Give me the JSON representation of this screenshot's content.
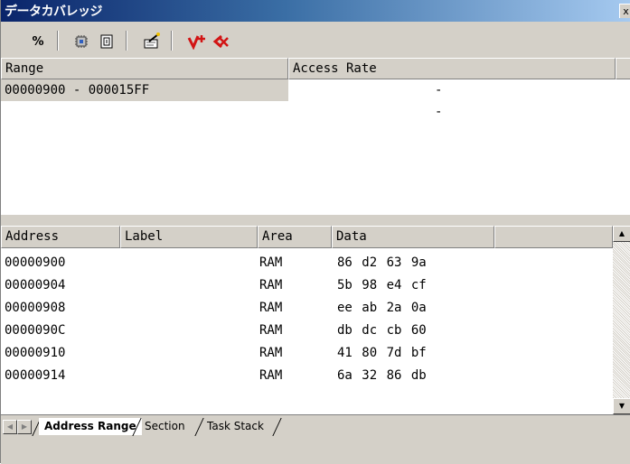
{
  "window": {
    "title": "データカバレッジ",
    "close_label": "x"
  },
  "toolbar": {
    "buttons": [
      {
        "name": "percent-button",
        "icon": "percent-icon",
        "label": "%"
      },
      {
        "name": "settings-button",
        "icon": "chip-settings-icon"
      },
      {
        "name": "info-button",
        "icon": "document-info-icon"
      },
      {
        "name": "edit-range-button",
        "icon": "wand-edit-icon"
      },
      {
        "name": "add-range-button",
        "icon": "add-red-icon"
      },
      {
        "name": "remove-range-button",
        "icon": "remove-red-icon"
      }
    ]
  },
  "range_table": {
    "headers": [
      "Range",
      "Access Rate"
    ],
    "rows": [
      {
        "range": "00000900 - 000015FF",
        "rate": "--"
      }
    ]
  },
  "data_table": {
    "headers": [
      "Address",
      "Label",
      "Area",
      "Data"
    ],
    "rows": [
      {
        "address": "00000900",
        "label": "",
        "area": "RAM",
        "data": "86 d2 63 9a"
      },
      {
        "address": "00000904",
        "label": "",
        "area": "RAM",
        "data": "5b 98 e4 cf"
      },
      {
        "address": "00000908",
        "label": "",
        "area": "RAM",
        "data": "ee ab 2a 0a"
      },
      {
        "address": "0000090C",
        "label": "",
        "area": "RAM",
        "data": "db dc cb 60"
      },
      {
        "address": "00000910",
        "label": "",
        "area": "RAM",
        "data": "41 80 7d bf"
      },
      {
        "address": "00000914",
        "label": "",
        "area": "RAM",
        "data": "6a 32 86 db"
      }
    ]
  },
  "tabs": [
    "Address Range",
    "Section",
    "Task Stack"
  ],
  "active_tab": "Address Range",
  "colors": {
    "title_start": "#0a246a",
    "title_end": "#a6caf0",
    "accent_red": "#d21414"
  }
}
